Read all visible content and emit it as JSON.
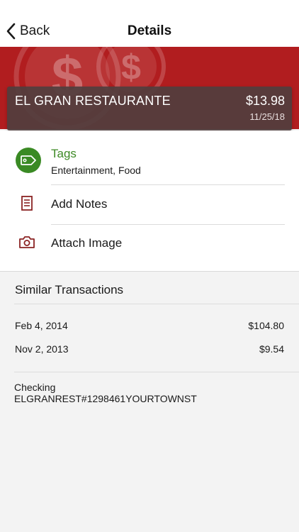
{
  "nav": {
    "back_label": "Back",
    "title": "Details"
  },
  "transaction": {
    "merchant": "EL GRAN RESTAURANTE",
    "amount": "$13.98",
    "date": "11/25/18"
  },
  "tags": {
    "title": "Tags",
    "values": "Entertainment, Food"
  },
  "actions": {
    "add_notes": "Add Notes",
    "attach_image": "Attach Image"
  },
  "similar": {
    "header": "Similar Transactions",
    "items": [
      {
        "date": "Feb 4, 2014",
        "amount": "$104.80"
      },
      {
        "date": "Nov 2, 2013",
        "amount": "$9.54"
      }
    ]
  },
  "account": {
    "type": "Checking",
    "description": "ELGRANREST#1298461YOURTOWNST"
  },
  "colors": {
    "brand_red": "#b11d1f",
    "tag_green": "#3a8a24",
    "icon_red": "#8b2323"
  },
  "icons": [
    "chevron-left-icon",
    "dollar-coin-icon",
    "tag-icon",
    "document-icon",
    "camera-icon"
  ]
}
